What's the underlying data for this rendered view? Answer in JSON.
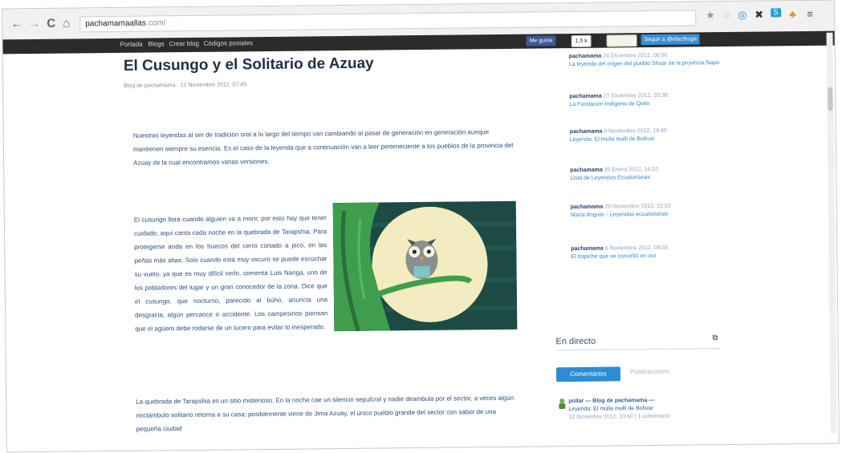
{
  "browser": {
    "back_glyph": "←",
    "forward_glyph": "→",
    "reload_glyph": "C",
    "home_glyph": "⌂",
    "url_host": "pachamamaallas",
    "url_path": ".com/",
    "star_glyph": "★",
    "extensions": [
      "☆",
      "◎",
      "✖",
      "S",
      "♣",
      "≡"
    ]
  },
  "site_menu": {
    "items": [
      "Portada",
      "Blogs",
      "Crear blog",
      "Códigos postales"
    ]
  },
  "social": {
    "like": "Me gusta",
    "like_count": "1,5 k",
    "follow": "Seguir a @elacthuga"
  },
  "article": {
    "title": "El Cusungo y el Solitario de Azuay",
    "meta": "Blog de pachamama · 12 Noviembre 2012, 07:45",
    "p1": "Nuestras leyendas al ser de tradición oral a lo largo del tiempo van cambiando al pasar de generación en generación aunque mantienen siempre su esencia. Es el caso de la leyenda que a continuación van a leer perteneciente a los pueblos de la provincia del Azuay de la cual encontramos varias versiones.",
    "p2": "El cusungo llora cuando alguien va a morir, por esto hay que tener cuidado, aquí canta cada noche en la quebrada de Tarapshia. Para protegerse anda en los huecos del cerro cortado a pico, en las peñas más altas. Solo cuando está muy oscuro se puede escuchar su vuelo, ya que es muy difícil verlo, comenta Luis Nanga, uno de los pobladores del lugar y un gran conocedor de la zona. Dice que el cusungo, que nocturno, parecido al búho, anuncia una desgracia, algún percance o accidente. Los campesinos piensan que el agüero debe rodarse de un lucero para evitar lo inesperado.",
    "p3": "La quebrada de Tarapshia es un sitio misterioso. En la noche cae un silencio sepulcral y nadie deambula por el sector, a veces algún noctámbulo solitario retorna a su casa; posiblemente viene de Jima Azuay, el único pueblo grande del sector con sabor de una pequeña ciudad"
  },
  "sidebar": {
    "recent": [
      {
        "who": "pachamama",
        "date": "24 Diciembre 2012, 06:00",
        "link": "La leyenda del origen del pueblo Shuar de la provincia Napo"
      },
      {
        "who": "pachamama",
        "date": "27 Diciembre 2012, 20:38",
        "link": "La Fundación Indígena de Quito"
      },
      {
        "who": "pachamama",
        "date": "8 Noviembre 2012, 19:45",
        "link": "Leyenda: El mulla mulli de Bolívar"
      },
      {
        "who": "pachamama",
        "date": "30 Enero 2012, 16:02",
        "link": "Lista de Leyendas Ecuatorianas"
      },
      {
        "who": "pachamama",
        "date": "28 Noviembre 2012, 22:10",
        "link": "María Angula – Leyendas ecuatorianas"
      },
      {
        "who": "pachamama",
        "date": "6 Noviembre 2012, 09:05",
        "link": "El trapiche que se convirtió en oro"
      }
    ],
    "live_title": "En directo",
    "live_icon": "⧉",
    "tab_comments": "Comentarios",
    "tab_posts": "Publicaciones",
    "comment": {
      "who": "pollar",
      "blog": "— Blog de pachamama —",
      "link": "Leyenda: El mulla mulli de Bolívar",
      "date": "12 Diciembre 2012, 10:40 | 1 comentario"
    }
  }
}
